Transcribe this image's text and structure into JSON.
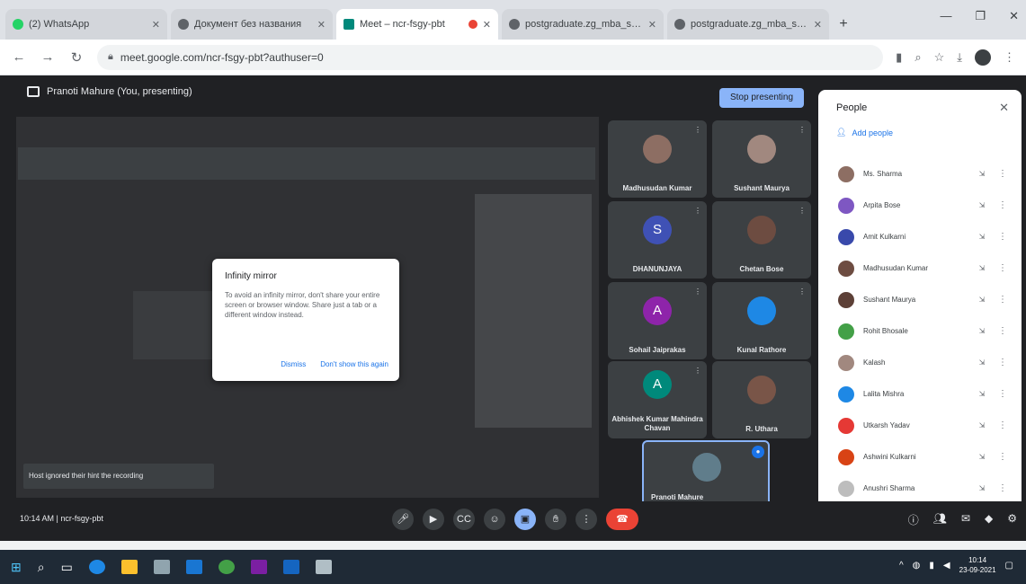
{
  "browser": {
    "tabs": [
      {
        "label": "(2) WhatsApp",
        "active": false
      },
      {
        "label": "Документ без названия",
        "active": false
      },
      {
        "label": "Meet – ncr-fsgy-pbt",
        "active": true
      },
      {
        "label": "postgraduate.zg_mba_se...",
        "active": false
      },
      {
        "label": "postgraduate.zg_mba_se...",
        "active": false
      }
    ],
    "url": "meet.google.com/ncr-fsgy-pbt?authuser=0"
  },
  "meet": {
    "presenting_label": "Pranoti Mahure (You, presenting)",
    "stop_presenting_label": "Stop presenting",
    "dialog": {
      "title": "Infinity mirror",
      "body": "To avoid an infinity mirror, don't share your entire screen or browser window. Share just a tab or a different window instead.",
      "dismiss": "Dismiss",
      "dont_show": "Don't show this again"
    },
    "recording_toast": "Host ignored their hint the recording",
    "tiles": [
      {
        "name": "Madhusudan Kumar",
        "initial": "",
        "color": "#8d6e63"
      },
      {
        "name": "Sushant Maurya",
        "initial": "",
        "color": "#a1887f"
      },
      {
        "name": "DHANUNJAYA",
        "initial": "S",
        "color": "#3f51b5"
      },
      {
        "name": "Chetan Bose",
        "initial": "",
        "color": "#6d4c41"
      },
      {
        "name": "Sohail Jaiprakas",
        "initial": "A",
        "color": "#8e24aa"
      },
      {
        "name": "Kunal Rathore",
        "initial": "",
        "color": "#1e88e5"
      },
      {
        "name": "Abhishek Kumar Mahindra Chavan",
        "initial": "A",
        "color": "#00897b"
      },
      {
        "name": "R. Uthara",
        "initial": "",
        "color": "#795548"
      }
    ],
    "self_tile": {
      "name": "Pranoti Mahure",
      "color": "#607d8b"
    },
    "people": {
      "title": "People",
      "add_people": "Add people",
      "list": [
        {
          "name": "Ms. Sharma",
          "color": "#8d6e63"
        },
        {
          "name": "Arpita Bose",
          "color": "#7e57c2"
        },
        {
          "name": "Amit Kulkarni",
          "color": "#3949ab"
        },
        {
          "name": "Madhusudan Kumar",
          "color": "#6d4c41"
        },
        {
          "name": "Sushant Maurya",
          "color": "#5d4037"
        },
        {
          "name": "Rohit Bhosale",
          "color": "#43a047"
        },
        {
          "name": "Kalash",
          "color": "#a1887f"
        },
        {
          "name": "Lalita Mishra",
          "color": "#1e88e5"
        },
        {
          "name": "Utkarsh Yadav",
          "color": "#e53935"
        },
        {
          "name": "Ashwini Kulkarni",
          "color": "#d84315"
        },
        {
          "name": "Anushri Sharma",
          "color": "#bdbdbd"
        }
      ]
    },
    "meeting_info": "10:14 AM | ncr-fsgy-pbt"
  },
  "taskbar": {
    "clock_time": "10:14",
    "clock_date": "23-09-2021"
  }
}
